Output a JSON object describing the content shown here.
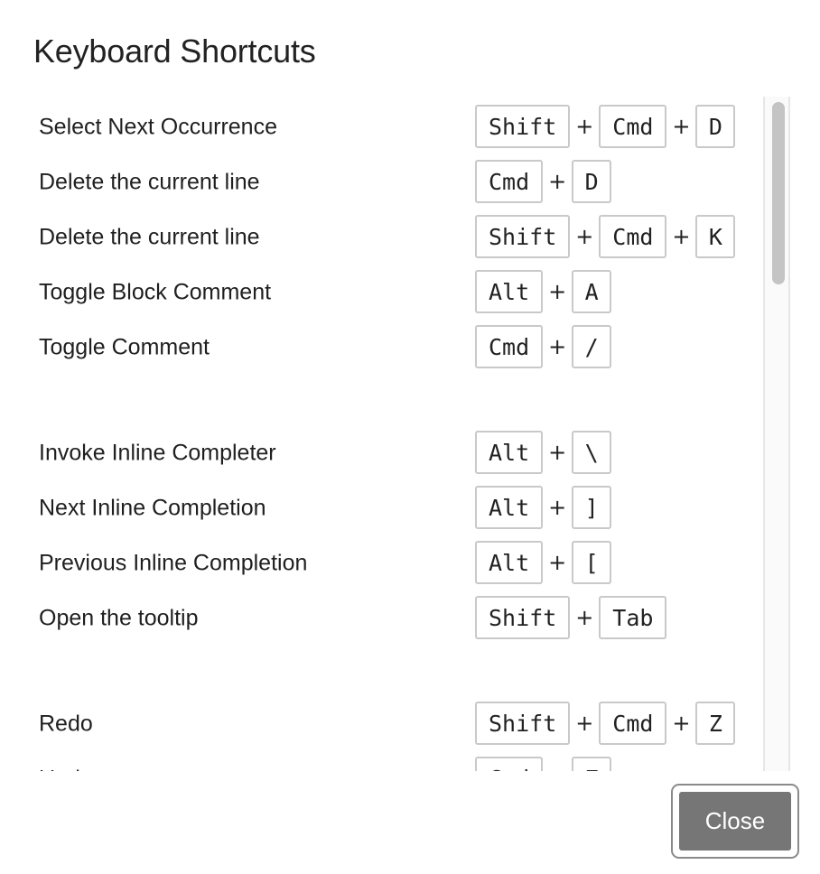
{
  "dialog": {
    "title": "Keyboard Shortcuts",
    "close_label": "Close"
  },
  "shortcuts": [
    {
      "label": "Select Next Occurrence",
      "keys": [
        "Shift",
        "Cmd",
        "D"
      ]
    },
    {
      "label": "Delete the current line",
      "keys": [
        "Cmd",
        "D"
      ]
    },
    {
      "label": "Delete the current line",
      "keys": [
        "Shift",
        "Cmd",
        "K"
      ]
    },
    {
      "label": "Toggle Block Comment",
      "keys": [
        "Alt",
        "A"
      ]
    },
    {
      "label": "Toggle Comment",
      "keys": [
        "Cmd",
        "/"
      ]
    },
    {
      "label": "Invoke Inline Completer",
      "keys": [
        "Alt",
        "\\"
      ]
    },
    {
      "label": "Next Inline Completion",
      "keys": [
        "Alt",
        "]"
      ]
    },
    {
      "label": "Previous Inline Completion",
      "keys": [
        "Alt",
        "["
      ]
    },
    {
      "label": "Open the tooltip",
      "keys": [
        "Shift",
        "Tab"
      ]
    },
    {
      "label": "Redo",
      "keys": [
        "Shift",
        "Cmd",
        "Z"
      ]
    },
    {
      "label": "Undo",
      "keys": [
        "Cmd",
        "Z"
      ]
    }
  ],
  "key_separator": "+",
  "icons": {
    "scrollbar": "vertical-scrollbar"
  }
}
